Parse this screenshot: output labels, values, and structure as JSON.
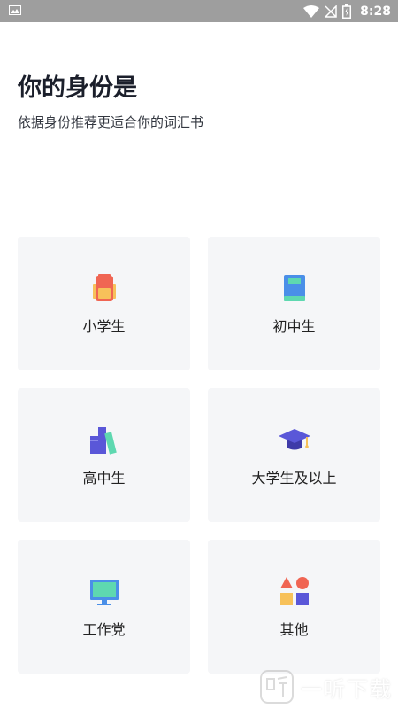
{
  "status_bar": {
    "time": "8:28"
  },
  "header": {
    "title": "你的身份是",
    "subtitle": "依据身份推荐更适合你的词汇书"
  },
  "options": [
    {
      "label": "小学生",
      "icon": "backpack-icon"
    },
    {
      "label": "初中生",
      "icon": "book-icon"
    },
    {
      "label": "高中生",
      "icon": "books-icon"
    },
    {
      "label": "大学生及以上",
      "icon": "graduation-cap-icon"
    },
    {
      "label": "工作党",
      "icon": "monitor-icon"
    },
    {
      "label": "其他",
      "icon": "shapes-icon"
    }
  ],
  "watermark": {
    "text": "一听下载"
  },
  "colors": {
    "card_background": "#f5f6f8",
    "status_bar": "#9e9e9e"
  }
}
